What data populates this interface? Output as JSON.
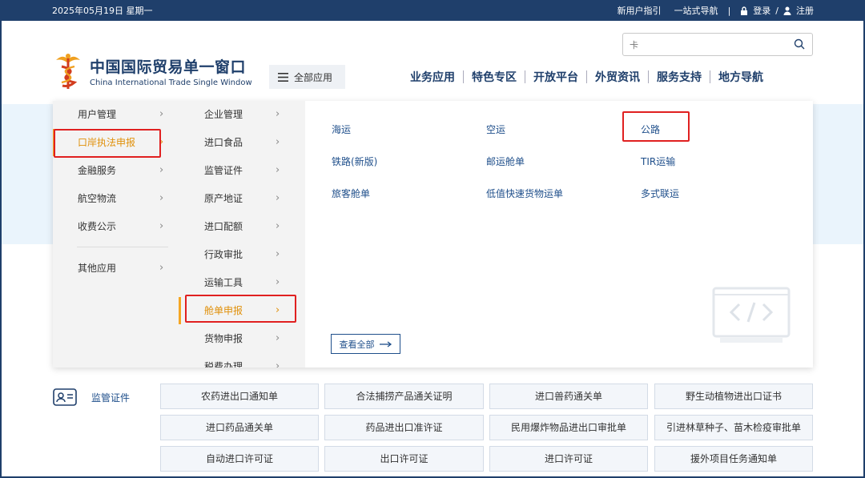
{
  "topbar": {
    "date": "2025年05月19日 星期一",
    "guide": "新用户指引",
    "onestop": "一站式导航",
    "login": "登录",
    "slash": "/",
    "register": "注册"
  },
  "search": {
    "placeholder": "卡"
  },
  "logo": {
    "cn": "中国国际贸易单一窗口",
    "en": "China International Trade Single Window"
  },
  "all_apps": "全部应用",
  "nav": [
    "业务应用",
    "特色专区",
    "开放平台",
    "外贸资讯",
    "服务支持",
    "地方导航"
  ],
  "menu": {
    "col1": [
      "用户管理",
      "口岸执法申报",
      "金融服务",
      "航空物流",
      "收费公示",
      "其他应用"
    ],
    "col1_active": "口岸执法申报",
    "col2": [
      "企业管理",
      "进口食品",
      "监管证件",
      "原产地证",
      "进口配额",
      "行政审批",
      "运输工具",
      "舱单申报",
      "货物申报",
      "税费办理"
    ],
    "col2_active": "舱单申报",
    "col3": [
      "海运",
      "空运",
      "公路",
      "铁路(新版)",
      "邮运舱单",
      "TIR运输",
      "旅客舱单",
      "低值快速货物运单",
      "多式联运"
    ],
    "view_all": "查看全部",
    "arrow": "›"
  },
  "certificates": {
    "section_label": "监管证件",
    "items": [
      "农药进出口通知单",
      "合法捕捞产品通关证明",
      "进口兽药通关单",
      "野生动植物进出口证书",
      "进口药品通关单",
      "药品进出口准许证",
      "民用爆炸物品进出口审批单",
      "引进林草种子、苗木检疫审批单",
      "自动进口许可证",
      "出口许可证",
      "进口许可证",
      "援外项目任务通知单"
    ]
  },
  "colors": {
    "brand": "#1f3f6b",
    "link": "#1f4f8b",
    "active": "#e0900a",
    "highlight": "#e02020"
  }
}
